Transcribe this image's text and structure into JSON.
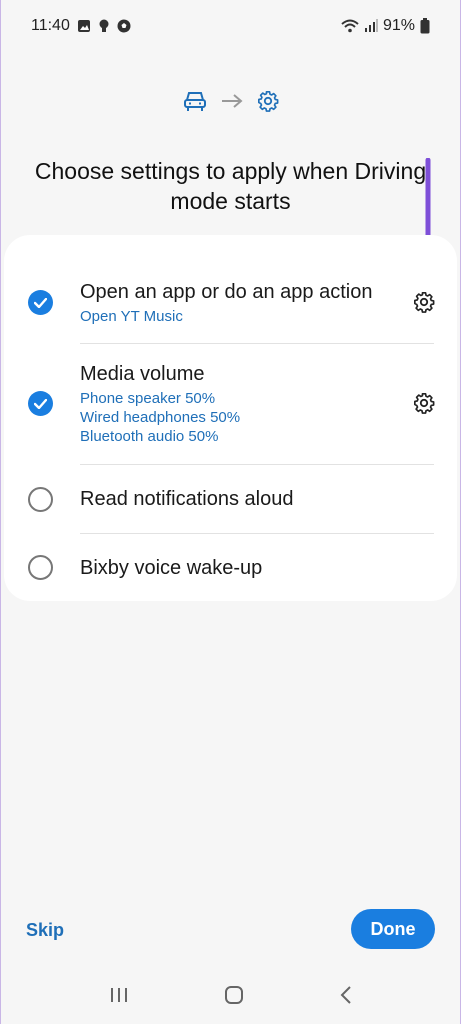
{
  "status": {
    "time": "11:40",
    "battery": "91%"
  },
  "header": {
    "title": "Choose settings to apply when Driving mode starts"
  },
  "settings": [
    {
      "title": "Open an app or do an app action",
      "subtitles": [
        "Open YT Music"
      ],
      "checked": true,
      "has_settings": true
    },
    {
      "title": "Media volume",
      "subtitles": [
        "Phone speaker 50%",
        "Wired headphones 50%",
        "Bluetooth audio 50%"
      ],
      "checked": true,
      "has_settings": true
    },
    {
      "title": "Read notifications aloud",
      "subtitles": [],
      "checked": false,
      "has_settings": false
    },
    {
      "title": "Bixby voice wake-up",
      "subtitles": [],
      "checked": false,
      "has_settings": false
    }
  ],
  "footer": {
    "skip_label": "Skip",
    "done_label": "Done"
  },
  "colors": {
    "accent": "#1a7ee0",
    "link": "#1f6fb8",
    "annotation_arrow": "#7e4fd8"
  }
}
